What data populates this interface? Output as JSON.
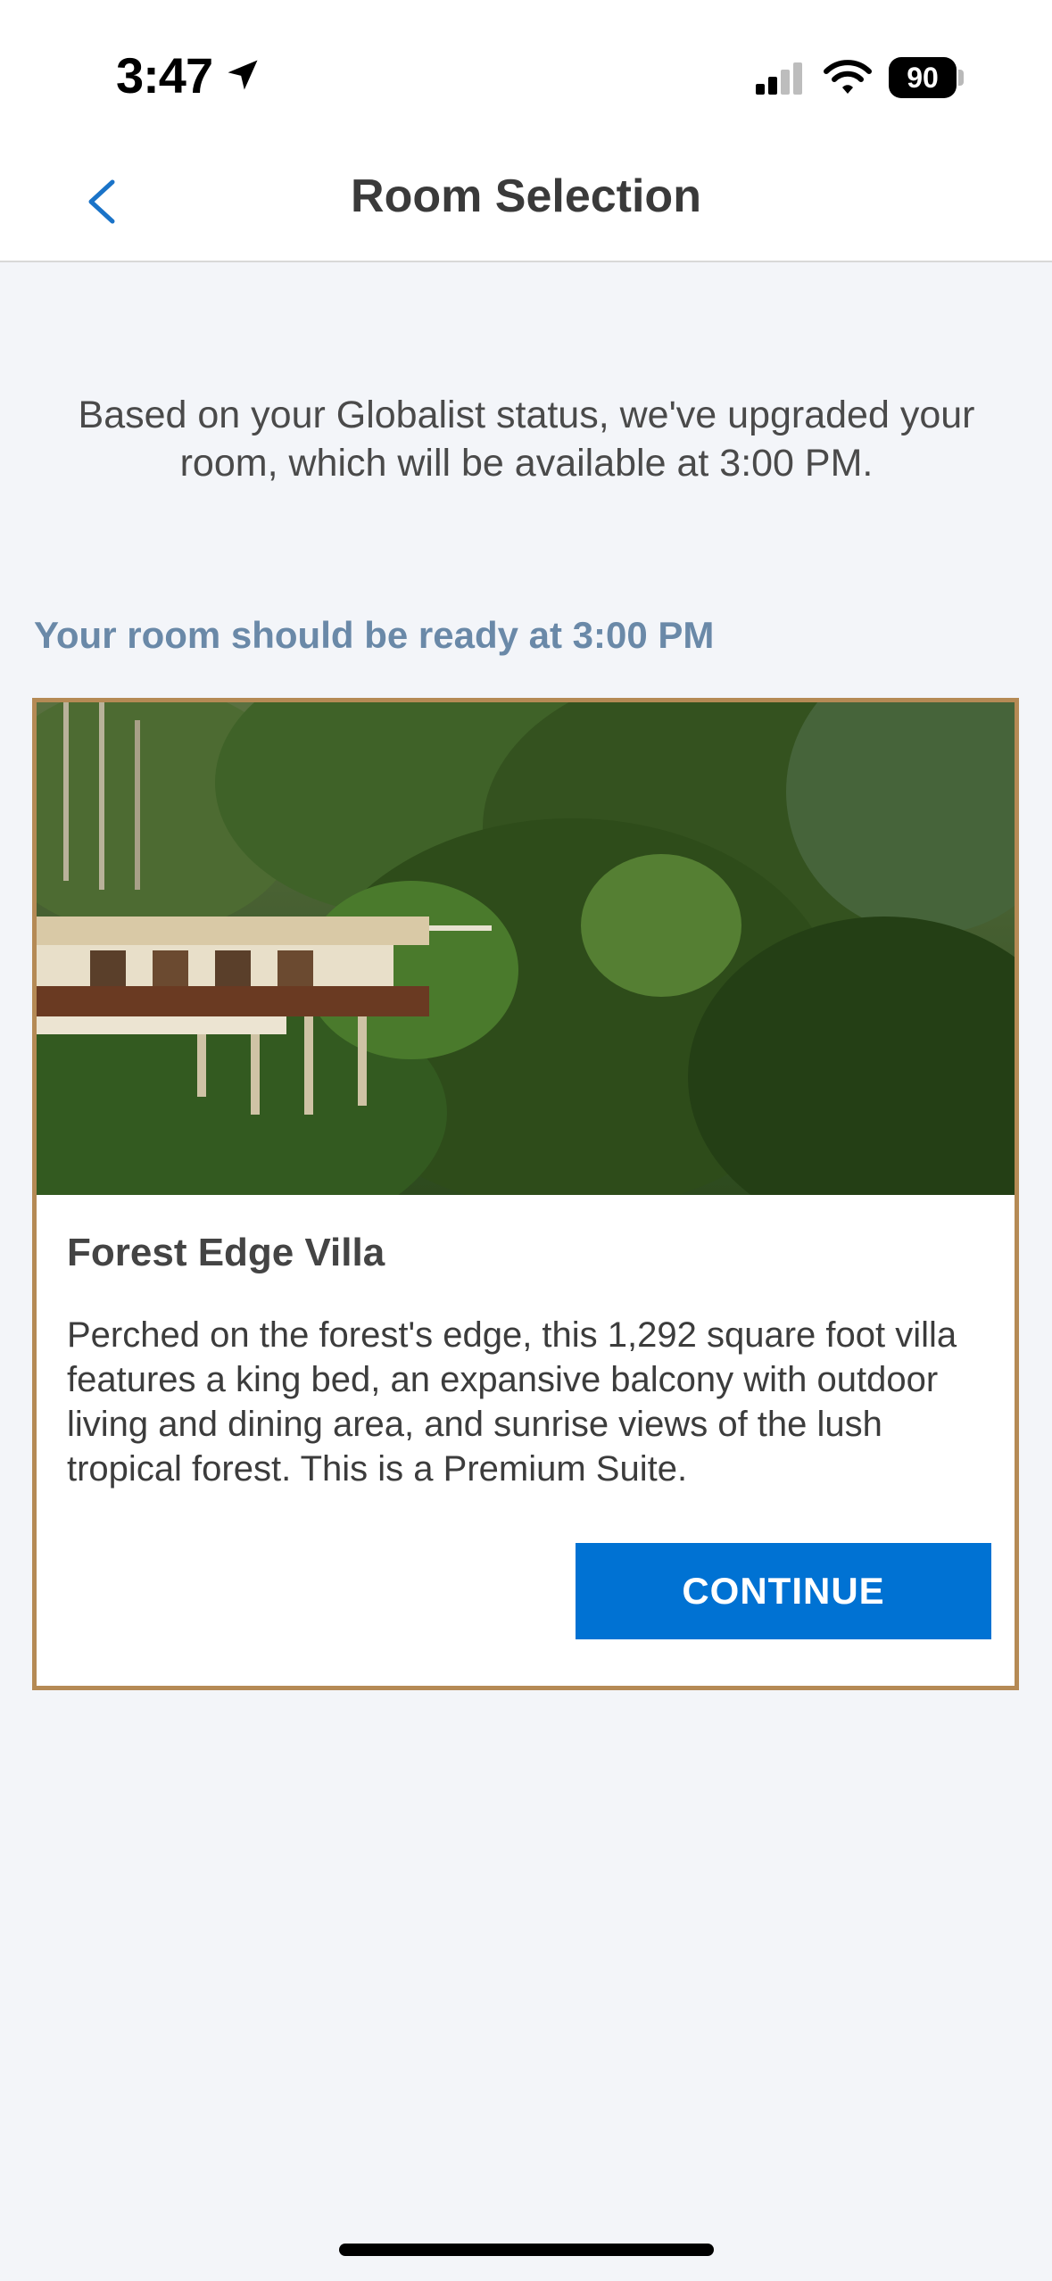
{
  "status_bar": {
    "time": "3:47",
    "battery": "90",
    "icons": [
      "location-arrow-icon",
      "cellular-signal-icon",
      "wifi-icon",
      "battery-icon"
    ]
  },
  "nav": {
    "title": "Room Selection",
    "back_icon": "chevron-left-icon"
  },
  "notice": "Based on your Globalist status, we've upgraded your room, which will be available at 3:00 PM.",
  "ready_label": "Your room should be ready at 3:00 PM",
  "room": {
    "name": "Forest Edge Villa",
    "description": "Perched on the forest's edge, this 1,292 square foot villa features a king bed, an expansive balcony with outdoor living and dining area, and sunrise views of the lush tropical forest. This is a Premium Suite.",
    "button_label": "CONTINUE"
  },
  "colors": {
    "accent": "#0072d3",
    "card_border": "#b58a55",
    "ready_label": "#6a89a8",
    "background": "#f3f5f9"
  }
}
